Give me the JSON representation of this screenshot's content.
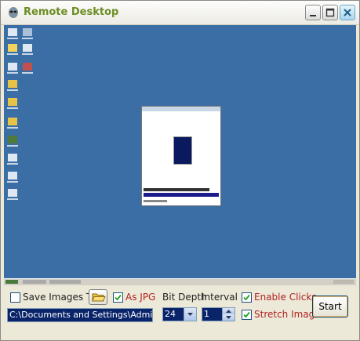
{
  "window": {
    "title": "Remote Desktop"
  },
  "controls": {
    "save_images_label": "Save Images To",
    "save_images_checked": false,
    "as_jpg_label": "As JPG",
    "as_jpg_checked": true,
    "path_value": "C:\\Documents and Settings\\Administr",
    "bit_depth_label": "Bit Depth",
    "bit_depth_value": "24",
    "interval_label": "Interval",
    "interval_value": "1",
    "enable_clicks_label": "Enable Clicks",
    "enable_clicks_checked": true,
    "stretch_image_label": "Stretch Image",
    "stretch_image_checked": true,
    "start_label": "Start"
  },
  "colors": {
    "title_text": "#6b8e23",
    "remote_desktop_bg": "#3a6ea5",
    "window_face": "#ECE9D8",
    "accent_red_label": "#b22222"
  },
  "icons": {
    "app": "alien-icon",
    "minimize": "minimize-icon",
    "maximize": "maximize-icon",
    "close": "close-icon",
    "folder": "folder-open-icon",
    "dropdown": "chevron-down-icon",
    "spin_up": "chevron-up-icon",
    "spin_down": "chevron-down-icon"
  }
}
